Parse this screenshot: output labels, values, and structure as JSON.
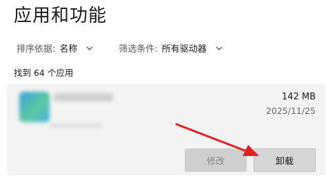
{
  "page": {
    "title": "应用和功能"
  },
  "filters": {
    "sort_label": "排序依据:",
    "sort_value": "名称",
    "filter_label": "筛选条件:",
    "filter_value": "所有驱动器"
  },
  "summary": {
    "count_text": "找到 64 个应用"
  },
  "app": {
    "icon": "app-icon-blurred",
    "size": "142 MB",
    "date": "2025/11/25",
    "modify_label": "修改",
    "uninstall_label": "卸载"
  },
  "annotation": {
    "arrow_color": "#e02020"
  },
  "icons": {
    "sort_chevron": "chevron-down-icon",
    "filter_chevron": "chevron-down-icon"
  }
}
